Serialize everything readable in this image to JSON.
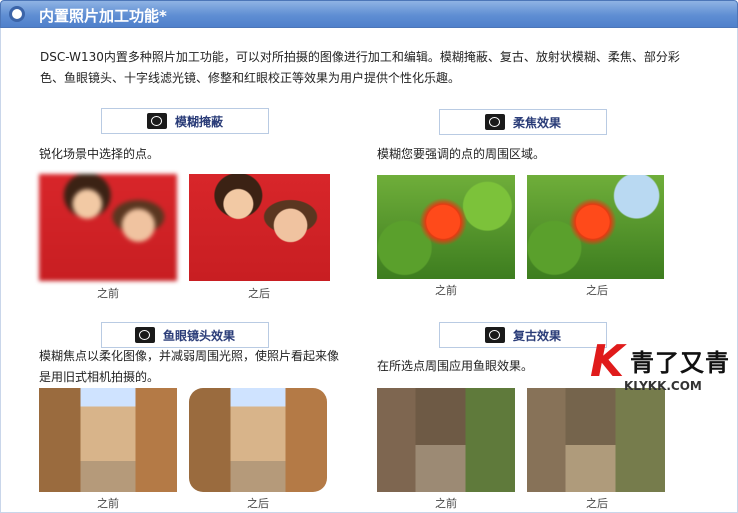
{
  "header": {
    "title": "内置照片加工功能*"
  },
  "intro": "DSC-W130内置多种照片加工功能，可以对所拍摄的图像进行加工和编辑。模糊掩蔽、复古、放射状模糊、柔焦、部分彩色、鱼眼镜头、十字线滤光镜、修整和红眼校正等效果为用户提供个性化乐趣。",
  "sections": [
    {
      "label": "模糊掩蔽",
      "icon": "camera-mask-icon",
      "desc": "锐化场景中选择的点。",
      "before": "之前",
      "after": "之后"
    },
    {
      "label": "柔焦效果",
      "icon": "camera-soft-icon",
      "desc": "模糊您要强调的点的周围区域。",
      "before": "之前",
      "after": "之后"
    },
    {
      "label": "鱼眼镜头效果",
      "icon": "camera-fisheye-icon",
      "desc": "模糊焦点以柔化图像，并减弱周围光照，使照片看起来像是用旧式相机拍摄的。",
      "before": "之前",
      "after": "之后"
    },
    {
      "label": "复古效果",
      "icon": "camera-retro-icon",
      "desc": "在所选点周围应用鱼眼效果。",
      "before": "之前",
      "after": "之后"
    }
  ],
  "watermark": {
    "letter": "K",
    "text": "青了又青",
    "url": "KLYKK.COM"
  }
}
